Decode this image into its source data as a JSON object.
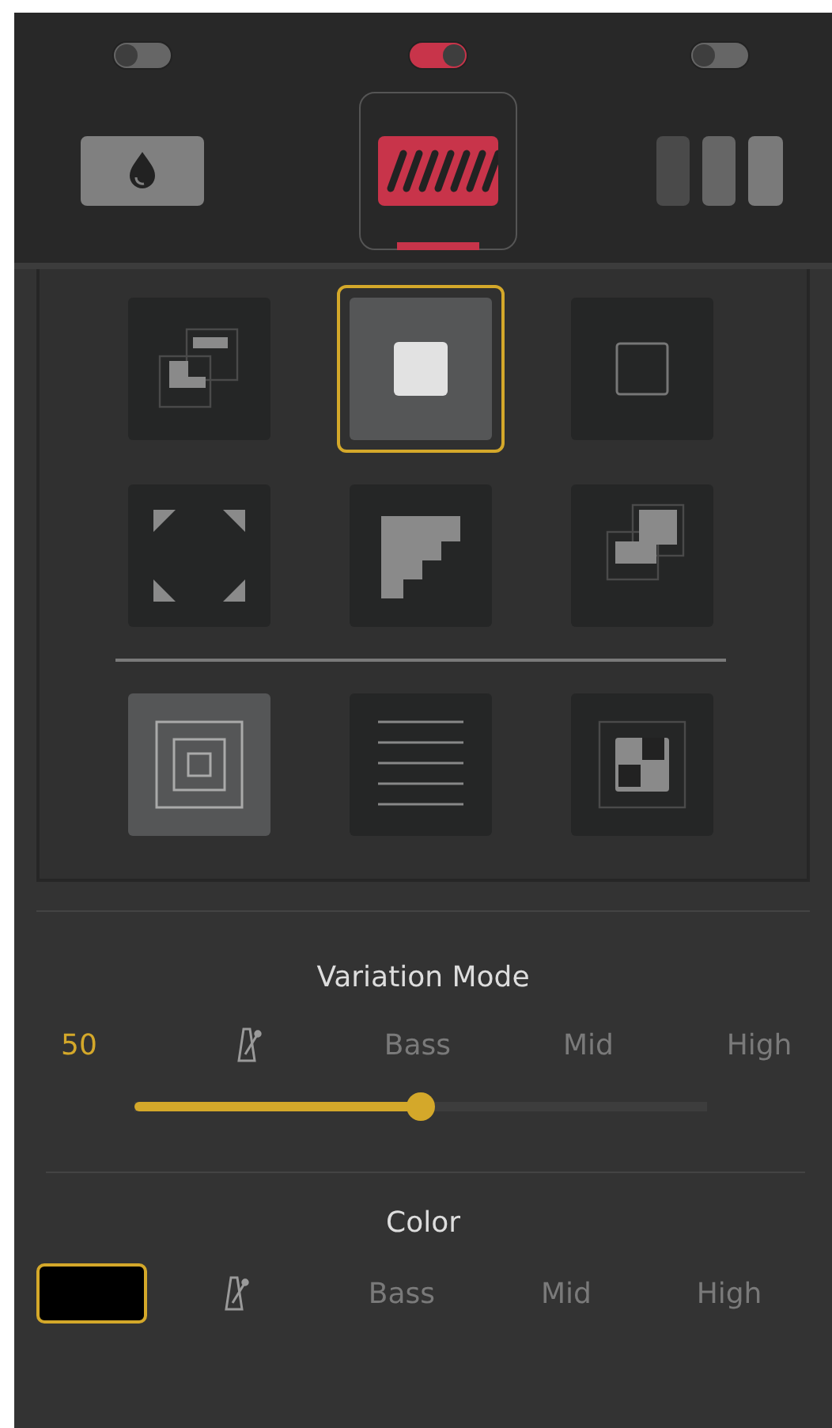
{
  "toggles": [
    {
      "on": false
    },
    {
      "on": true
    },
    {
      "on": false
    }
  ],
  "modes": [
    {
      "kind": "drop",
      "selected": false
    },
    {
      "kind": "stripes",
      "selected": true
    },
    {
      "kind": "bars",
      "selected": false
    }
  ],
  "tiles": [
    {
      "kind": "overlap",
      "selected": false,
      "highlighted": false
    },
    {
      "kind": "solid",
      "selected": true,
      "highlighted": true
    },
    {
      "kind": "outline",
      "selected": false,
      "highlighted": false
    },
    {
      "kind": "corners",
      "selected": false,
      "highlighted": false
    },
    {
      "kind": "stairs",
      "selected": false,
      "highlighted": false
    },
    {
      "kind": "blocks",
      "selected": false,
      "highlighted": false
    }
  ],
  "tiles_extra": [
    {
      "kind": "nested",
      "selected": false,
      "highlighted": true
    },
    {
      "kind": "lines",
      "selected": false,
      "highlighted": false
    },
    {
      "kind": "checker",
      "selected": false,
      "highlighted": false
    }
  ],
  "variation": {
    "title": "Variation Mode",
    "value": "50",
    "level": 0.5,
    "sources": [
      {
        "kind": "metronome",
        "selected": false
      },
      {
        "kind": "text",
        "label": "Bass",
        "selected": false
      },
      {
        "kind": "text",
        "label": "Mid",
        "selected": false
      },
      {
        "kind": "text",
        "label": "High",
        "selected": false
      }
    ]
  },
  "color": {
    "title": "Color",
    "swatch": {
      "color": "#000000",
      "selected": true
    },
    "sources": [
      {
        "kind": "metronome",
        "selected": false
      },
      {
        "kind": "text",
        "label": "Bass",
        "selected": false
      },
      {
        "kind": "text",
        "label": "Mid",
        "selected": false
      },
      {
        "kind": "text",
        "label": "High",
        "selected": false
      }
    ]
  }
}
